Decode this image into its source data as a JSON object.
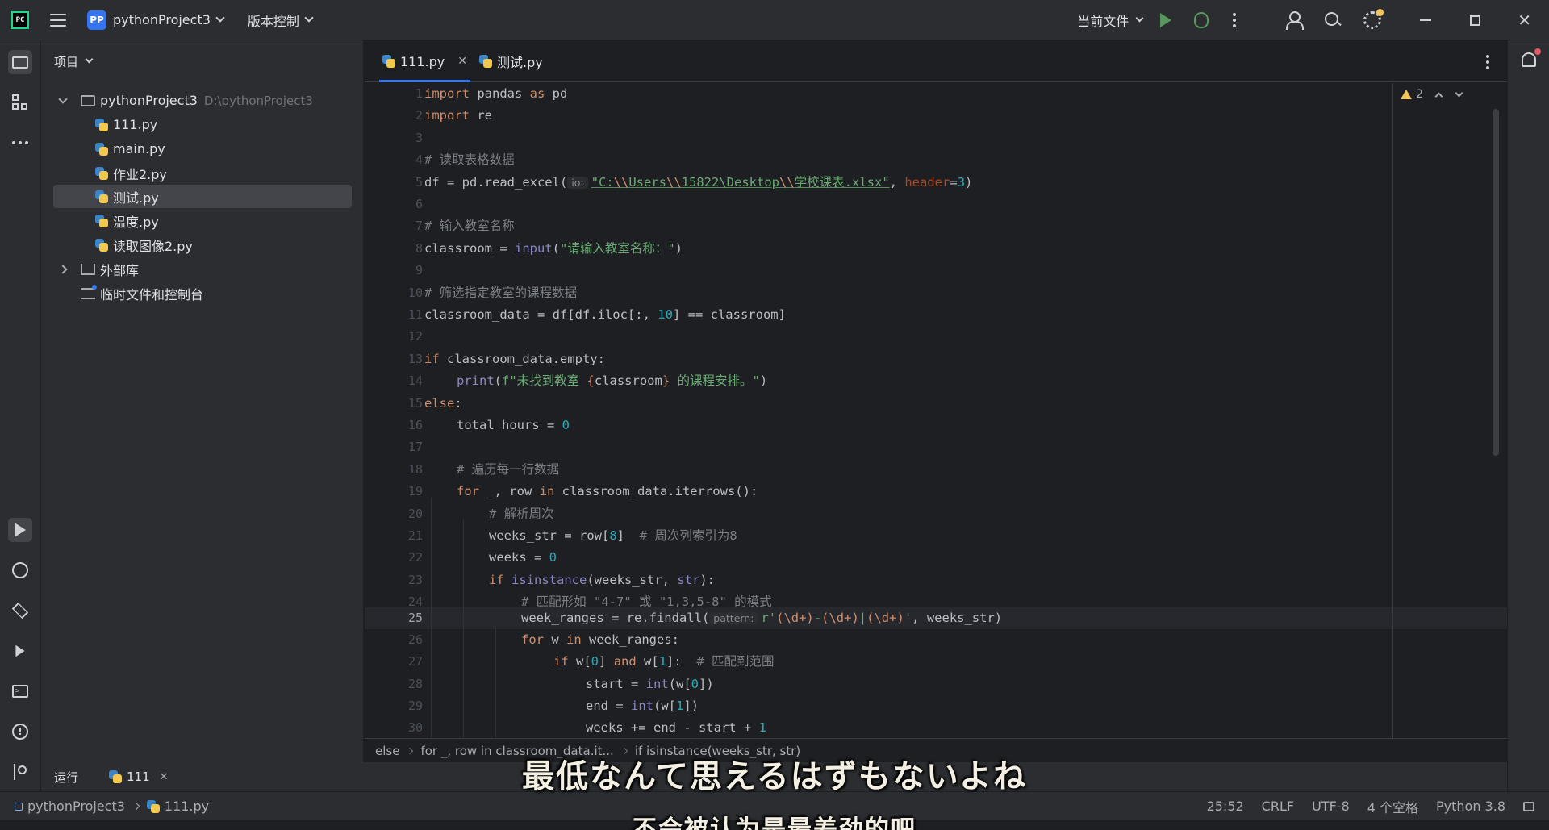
{
  "titlebar": {
    "app_logo": "PC",
    "project_badge": "PP",
    "project_name": "pythonProject3",
    "vcs_label": "版本控制",
    "current_file_label": "当前文件"
  },
  "project_panel": {
    "title": "项目",
    "root_name": "pythonProject3",
    "root_path": "D:\\pythonProject3",
    "files": [
      "111.py",
      "main.py",
      "作业2.py",
      "测试.py",
      "温度.py",
      "读取图像2.py"
    ],
    "selected_file": "测试.py",
    "external_libs": "外部库",
    "scratches": "临时文件和控制台"
  },
  "tabs": [
    {
      "label": "111.py",
      "active": true
    },
    {
      "label": "测试.py",
      "active": false
    }
  ],
  "editor": {
    "warning_count": "2",
    "current_line": 25,
    "line_numbers": [
      "1",
      "2",
      "3",
      "4",
      "5",
      "6",
      "7",
      "8",
      "9",
      "10",
      "11",
      "12",
      "13",
      "14",
      "15",
      "16",
      "17",
      "18",
      "19",
      "20",
      "21",
      "22",
      "23",
      "24",
      "25",
      "26",
      "27",
      "28",
      "29",
      "30"
    ],
    "code": {
      "l1_a": "import",
      "l1_b": " pandas ",
      "l1_c": "as",
      "l1_d": " pd",
      "l2_a": "import",
      "l2_b": " re",
      "l4": "# 读取表格数据",
      "l5_a": "df = pd.read_excel(",
      "l5_hint": "io:",
      "l5_str1": "\"C:",
      "l5_e1": "\\\\",
      "l5_str2": "Users",
      "l5_e2": "\\\\",
      "l5_str3": "15822\\Desktop",
      "l5_e3": "\\\\",
      "l5_str4": "学校课表.xlsx\"",
      "l5_b": ", ",
      "l5_kw": "header",
      "l5_c": "=",
      "l5_num": "3",
      "l5_d": ")",
      "l7": "# 输入教室名称",
      "l8_a": "classroom = ",
      "l8_bi": "input",
      "l8_b": "(",
      "l8_str": "\"请输入教室名称：\"",
      "l8_c": ")",
      "l10": "# 筛选指定教室的课程数据",
      "l11_a": "classroom_data = df[df.iloc[:, ",
      "l11_num": "10",
      "l11_b": "] == classroom]",
      "l13_kw": "if",
      "l13_a": " classroom_data.empty:",
      "l14_bi": "print",
      "l14_a": "(",
      "l14_str1": "f\"未找到教室 ",
      "l14_br1": "{",
      "l14_var": "classroom",
      "l14_br2": "}",
      "l14_str2": " 的课程安排。\"",
      "l14_b": ")",
      "l15_kw": "else",
      "l15_a": ":",
      "l16_a": "total_hours = ",
      "l16_num": "0",
      "l18": "# 遍历每一行数据",
      "l19_kw1": "for",
      "l19_a": " _, row ",
      "l19_kw2": "in",
      "l19_b": " classroom_data.iterrows():",
      "l20": "# 解析周次",
      "l21_a": "weeks_str = row[",
      "l21_num": "8",
      "l21_b": "]  ",
      "l21_cm": "# 周次列索引为8",
      "l22_a": "weeks = ",
      "l22_num": "0",
      "l23_kw": "if",
      "l23_bi": " isinstance",
      "l23_a": "(weeks_str, ",
      "l23_bi2": "str",
      "l23_b": "):",
      "l24": "# 匹配形如 \"4-7\" 或 \"1,3,5-8\" 的模式",
      "l25_a": "week_ranges = re.findall(",
      "l25_hint": "pattern:",
      "l25_str1": "r'",
      "l25_re1": "(\\d+)",
      "l25_str2": "-",
      "l25_re2": "(\\d+)",
      "l25_str3": "|",
      "l25_re3": "(\\d+)",
      "l25_str4": "'",
      "l25_b": ", weeks_str)",
      "l26_kw1": "for",
      "l26_a": " w ",
      "l26_kw2": "in",
      "l26_b": " week_ranges:",
      "l27_kw1": "if",
      "l27_a": " w[",
      "l27_n1": "0",
      "l27_b": "] ",
      "l27_kw2": "and",
      "l27_c": " w[",
      "l27_n2": "1",
      "l27_d": "]:  ",
      "l27_cm": "# 匹配到范围",
      "l28_a": "start = ",
      "l28_bi": "int",
      "l28_b": "(w[",
      "l28_num": "0",
      "l28_c": "])",
      "l29_a": "end = ",
      "l29_bi": "int",
      "l29_b": "(w[",
      "l29_num": "1",
      "l29_c": "])",
      "l30_a": "weeks += end - start + ",
      "l30_num": "1"
    }
  },
  "breadcrumb": [
    "else",
    "for _, row in classroom_data.it...",
    "if isinstance(weeks_str, str)"
  ],
  "runbar": {
    "label": "运行",
    "tab": "111"
  },
  "statusbar": {
    "project": "pythonProject3",
    "file": "111.py",
    "position": "25:52",
    "line_sep": "CRLF",
    "encoding": "UTF-8",
    "indent": "4 个空格",
    "interpreter": "Python 3.8"
  },
  "subtitles": {
    "japanese": "最低なんて思えるはずもないよね",
    "chinese": "不会被认为是最差劲的吧"
  }
}
